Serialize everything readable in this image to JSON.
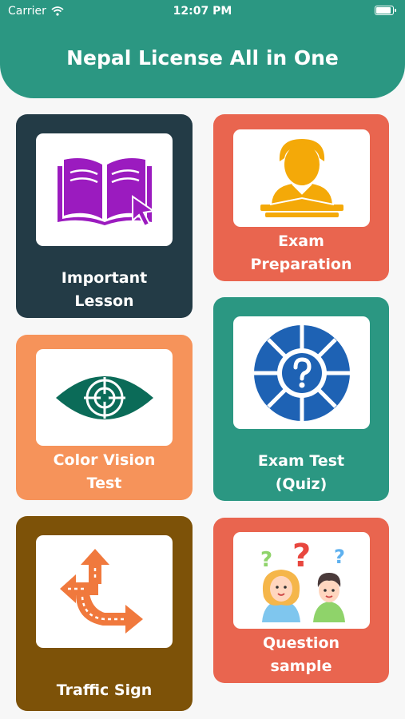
{
  "status_bar": {
    "carrier": "Carrier",
    "time": "12:07 PM"
  },
  "header": {
    "title": "Nepal License All in One"
  },
  "colors": {
    "header": "#2b9782",
    "important_lesson": "#233b46",
    "exam_preparation": "#e9654f",
    "color_vision": "#f6935a",
    "exam_test": "#2b9782",
    "traffic_sign": "#7d5208",
    "question_sample": "#e9654f"
  },
  "cards": {
    "important_lesson": {
      "line1": "Important",
      "line2": "Lesson",
      "icon": "open-book-icon"
    },
    "exam_preparation": {
      "line1": "Exam",
      "line2": "Preparation",
      "icon": "student-desk-icon"
    },
    "color_vision": {
      "line1": "Color Vision",
      "line2": "Test",
      "icon": "eye-icon"
    },
    "exam_test": {
      "line1": "Exam Test",
      "line2": "(Quiz)",
      "icon": "quiz-wheel-icon"
    },
    "traffic_sign": {
      "line1": "Traffic Sign",
      "icon": "road-arrows-icon"
    },
    "question_sample": {
      "line1": "Question",
      "line2": "sample",
      "icon": "question-people-icon"
    }
  }
}
